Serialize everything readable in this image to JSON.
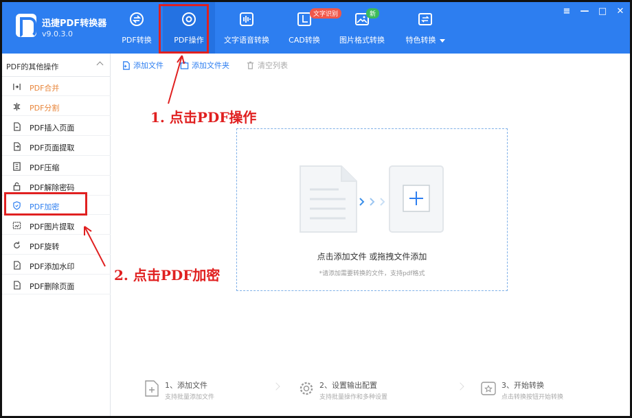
{
  "app": {
    "name": "迅捷PDF转换器",
    "version": "v9.0.3.0"
  },
  "nav": [
    {
      "label": "PDF转换",
      "icon": "pdf-convert-icon"
    },
    {
      "label": "PDF操作",
      "icon": "pdf-operation-icon",
      "active": true
    },
    {
      "label": "文字语音转换",
      "icon": "audio-wave-icon"
    },
    {
      "label": "CAD转换",
      "icon": "cad-icon"
    },
    {
      "label": "图片格式转换",
      "icon": "image-icon",
      "badge": "新"
    },
    {
      "label": "特色转换",
      "icon": "feature-convert-icon",
      "badge": "文字识别"
    }
  ],
  "window_controls": [
    "≡",
    "—",
    "□",
    "✕"
  ],
  "sidebar": {
    "header": "PDF的其他操作",
    "items": [
      {
        "label": "PDF合并",
        "icon": "merge-icon",
        "color": "#e8853a"
      },
      {
        "label": "PDF分割",
        "icon": "split-icon",
        "color": "#e8853a"
      },
      {
        "label": "PDF插入页面",
        "icon": "insert-page-icon"
      },
      {
        "label": "PDF页面提取",
        "icon": "extract-page-icon"
      },
      {
        "label": "PDF压缩",
        "icon": "compress-icon"
      },
      {
        "label": "PDF解除密码",
        "icon": "unlock-icon"
      },
      {
        "label": "PDF加密",
        "icon": "encrypt-icon",
        "color": "#2d7ef0"
      },
      {
        "label": "PDF图片提取",
        "icon": "image-extract-icon"
      },
      {
        "label": "PDF旋转",
        "icon": "rotate-icon"
      },
      {
        "label": "PDF添加水印",
        "icon": "watermark-icon"
      },
      {
        "label": "PDF删除页面",
        "icon": "delete-page-icon"
      }
    ]
  },
  "toolbar": {
    "add_file": "添加文件",
    "add_folder": "添加文件夹",
    "clear_list": "清空列表"
  },
  "dropzone": {
    "title": "点击添加文件 或拖拽文件添加",
    "hint": "*请添加需要转换的文件，支持pdf格式"
  },
  "steps": [
    {
      "title": "1、添加文件",
      "sub": "支持批量添加文件",
      "icon": "add-file-icon"
    },
    {
      "title": "2、设置输出配置",
      "sub": "支持批量操作和多种设置",
      "icon": "settings-gear-icon"
    },
    {
      "title": "3、开始转换",
      "sub": "点击转换按钮开始转换",
      "icon": "start-convert-icon"
    }
  ],
  "annotations": {
    "step1": "1. 点击PDF操作",
    "step2": "2. 点击PDF加密"
  },
  "colors": {
    "header": "#2d7ef0",
    "accent": "#2d7ef0",
    "orange": "#e8853a",
    "annotation": "#e02020"
  }
}
